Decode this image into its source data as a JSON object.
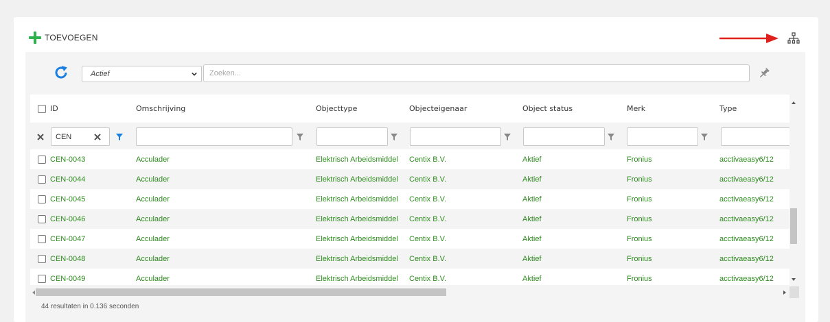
{
  "toolbar": {
    "add_label": "TOEVOEGEN"
  },
  "filters": {
    "status_value": "Actief",
    "search_placeholder": "Zoeken..."
  },
  "colors": {
    "accent_green": "#2fb24b",
    "link_green": "#2e8b1f",
    "arrow_red": "#e0201c",
    "filter_blue": "#1a7fe0"
  },
  "table": {
    "columns": [
      {
        "key": "id",
        "label": "ID"
      },
      {
        "key": "omschrijving",
        "label": "Omschrijving"
      },
      {
        "key": "objecttype",
        "label": "Objecttype"
      },
      {
        "key": "objecteigenaar",
        "label": "Objecteigenaar"
      },
      {
        "key": "status",
        "label": "Object status"
      },
      {
        "key": "merk",
        "label": "Merk"
      },
      {
        "key": "type",
        "label": "Type"
      }
    ],
    "id_filter_value": "CEN",
    "rows": [
      {
        "id": "CEN-0043",
        "omschrijving": "Acculader",
        "objecttype": "Elektrisch Arbeidsmiddel",
        "objecteigenaar": "Centix B.V.",
        "status": "Aktief",
        "merk": "Fronius",
        "type": "acctivaeasy6/12"
      },
      {
        "id": "CEN-0044",
        "omschrijving": "Acculader",
        "objecttype": "Elektrisch Arbeidsmiddel",
        "objecteigenaar": "Centix B.V.",
        "status": "Aktief",
        "merk": "Fronius",
        "type": "acctivaeasy6/12"
      },
      {
        "id": "CEN-0045",
        "omschrijving": "Acculader",
        "objecttype": "Elektrisch Arbeidsmiddel",
        "objecteigenaar": "Centix B.V.",
        "status": "Aktief",
        "merk": "Fronius",
        "type": "acctivaeasy6/12"
      },
      {
        "id": "CEN-0046",
        "omschrijving": "Acculader",
        "objecttype": "Elektrisch Arbeidsmiddel",
        "objecteigenaar": "Centix B.V.",
        "status": "Aktief",
        "merk": "Fronius",
        "type": "acctivaeasy6/12"
      },
      {
        "id": "CEN-0047",
        "omschrijving": "Acculader",
        "objecttype": "Elektrisch Arbeidsmiddel",
        "objecteigenaar": "Centix B.V.",
        "status": "Aktief",
        "merk": "Fronius",
        "type": "acctivaeasy6/12"
      },
      {
        "id": "CEN-0048",
        "omschrijving": "Acculader",
        "objecttype": "Elektrisch Arbeidsmiddel",
        "objecteigenaar": "Centix B.V.",
        "status": "Aktief",
        "merk": "Fronius",
        "type": "acctivaeasy6/12"
      },
      {
        "id": "CEN-0049",
        "omschrijving": "Acculader",
        "objecttype": "Elektrisch Arbeidsmiddel",
        "objecteigenaar": "Centix B.V.",
        "status": "Aktief",
        "merk": "Fronius",
        "type": "acctivaeasy6/12"
      }
    ]
  },
  "footer": {
    "result_text": "44 resultaten in 0.136 seconden"
  },
  "icons": {
    "add": "plus-icon",
    "hierarchy": "hierarchy-icon",
    "arrow": "red-arrow",
    "refresh": "refresh-icon",
    "pin": "pin-icon",
    "clear": "clear-x-icon",
    "filter": "filter-funnel-icon"
  }
}
